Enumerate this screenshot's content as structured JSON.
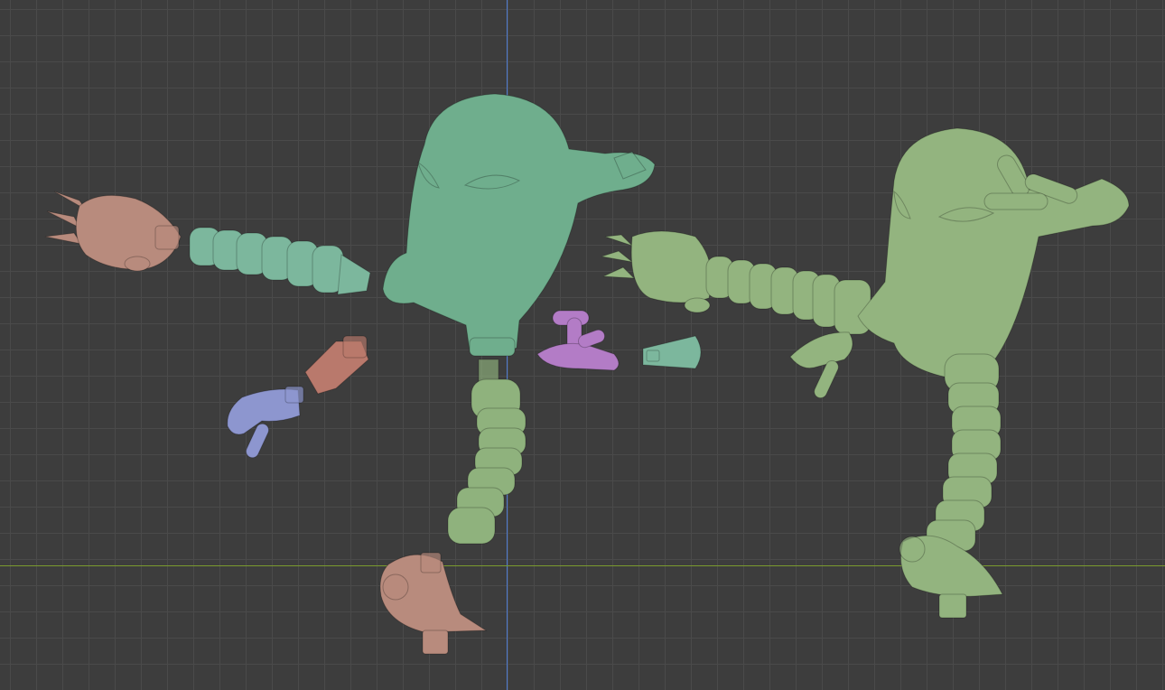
{
  "viewport": {
    "type": "3d-viewport",
    "grid": true,
    "axes": {
      "x_color": "#7a9a2e",
      "y_color": "#4f7bd0"
    }
  },
  "colors": {
    "background": "#3d3d3d",
    "teal_parts": "#7cb79d",
    "head_teal": "#6fae8d",
    "olive_green": "#8fb27d",
    "assembled_green": "#93b47f",
    "salmon": "#b88b7d",
    "lavender": "#8d96cf",
    "purple": "#b37cc6",
    "rust": "#b9796c"
  },
  "objects": [
    {
      "name": "claw-hand-salmon",
      "color": "salmon"
    },
    {
      "name": "arm-segments-teal",
      "color": "teal_parts"
    },
    {
      "name": "head-teal",
      "color": "head_teal"
    },
    {
      "name": "neck-segments-green",
      "color": "olive_green"
    },
    {
      "name": "foot-salmon",
      "color": "salmon"
    },
    {
      "name": "wrist-piece-rust",
      "color": "rust"
    },
    {
      "name": "hand-lavender",
      "color": "lavender"
    },
    {
      "name": "hand-purple",
      "color": "purple"
    },
    {
      "name": "cup-connector-teal",
      "color": "teal_parts"
    },
    {
      "name": "assembled-figure-green",
      "color": "assembled_green"
    }
  ]
}
